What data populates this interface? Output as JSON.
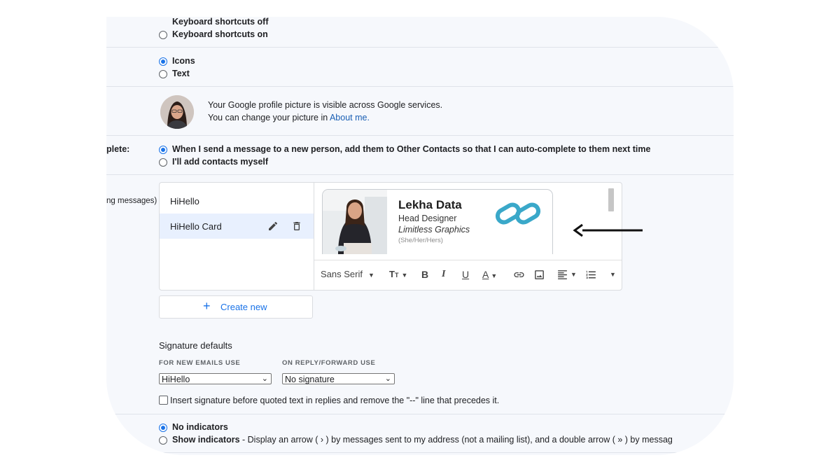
{
  "keyboard": {
    "off_label": "Keyboard shortcuts off",
    "on_label": "Keyboard shortcuts on"
  },
  "button_labels": {
    "icons_label": "Icons",
    "text_label": "Text"
  },
  "profile": {
    "line1": "Your Google profile picture is visible across Google services.",
    "line2_prefix": "You can change your picture in ",
    "line2_link": "About me."
  },
  "autocomplete": {
    "section_label": "plete:",
    "option1": "When I send a message to a new person, add them to Other Contacts so that I can auto-complete to them next time",
    "option2": "I'll add contacts myself"
  },
  "signature": {
    "section_label": "ng messages)",
    "items": [
      {
        "label": "HiHello"
      },
      {
        "label": "HiHello Card"
      }
    ],
    "card": {
      "name": "Lekha Data",
      "title": "Head Designer",
      "company": "Limitless Graphics",
      "pronouns": "(She/Her/Hers)"
    },
    "toolbar": {
      "font": "Sans Serif"
    },
    "create_new": "Create new",
    "defaults_title": "Signature defaults",
    "new_emails_label": "FOR NEW EMAILS USE",
    "reply_label": "ON REPLY/FORWARD USE",
    "new_emails_value": "HiHello",
    "reply_value": "No signature",
    "insert_before_label": "Insert signature before quoted text in replies and remove the \"--\" line that precedes it."
  },
  "indicators": {
    "no_label": "No indicators",
    "show_label": "Show indicators",
    "show_desc": " - Display an arrow ( › ) by messages sent to my address (not a mailing list), and a double arrow ( » ) by messag"
  },
  "colors": {
    "accent": "#1a73e8",
    "selected_bg": "#e8f0fe",
    "logo": "#3aa8c9"
  }
}
